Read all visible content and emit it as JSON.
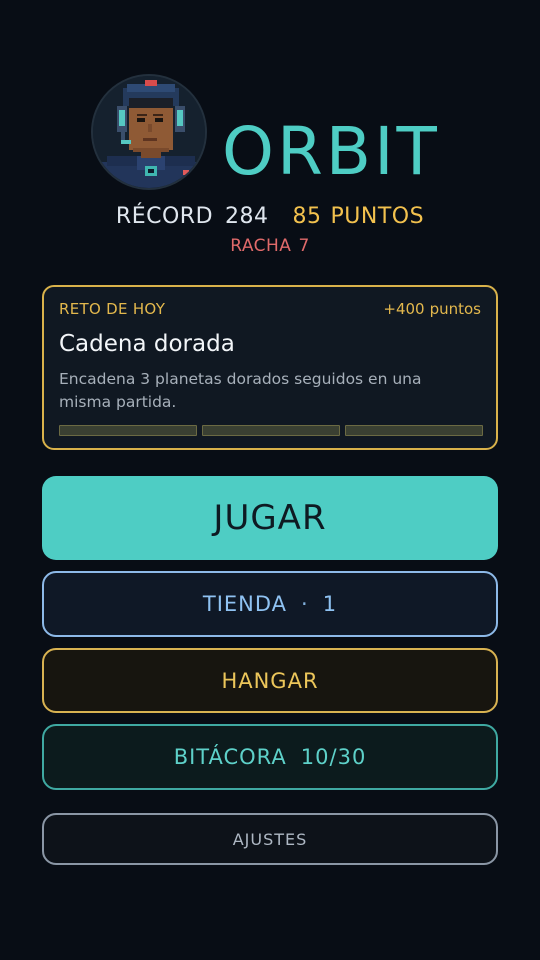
{
  "header": {
    "title": "ORBIT",
    "record_label": "RÉCORD",
    "record_value": "284",
    "points_value": "85",
    "points_label": "PUNTOS",
    "streak_label": "RACHA",
    "streak_value": "7",
    "avatar": "pilot-portrait-icon"
  },
  "challenge": {
    "label": "RETO DE HOY",
    "reward_value": "+400",
    "reward_label": "puntos",
    "title": "Cadena dorada",
    "description": "Encadena 3 planetas dorados seguidos en una misma partida.",
    "progress_total": 3,
    "progress_done": 0
  },
  "menu": {
    "play_label": "JUGAR",
    "shop_label": "TIENDA",
    "shop_separator": "·",
    "shop_badge": "1",
    "hangar_label": "HANGAR",
    "logbook_label": "BITÁCORA",
    "logbook_progress": "10/30",
    "settings_label": "AJUSTES"
  },
  "colors": {
    "background": "#080d15",
    "accent_teal": "#4ecdc4",
    "gold": "#e3b84d",
    "streak_red": "#e06a6a",
    "shop_blue": "#8fc2f2"
  }
}
